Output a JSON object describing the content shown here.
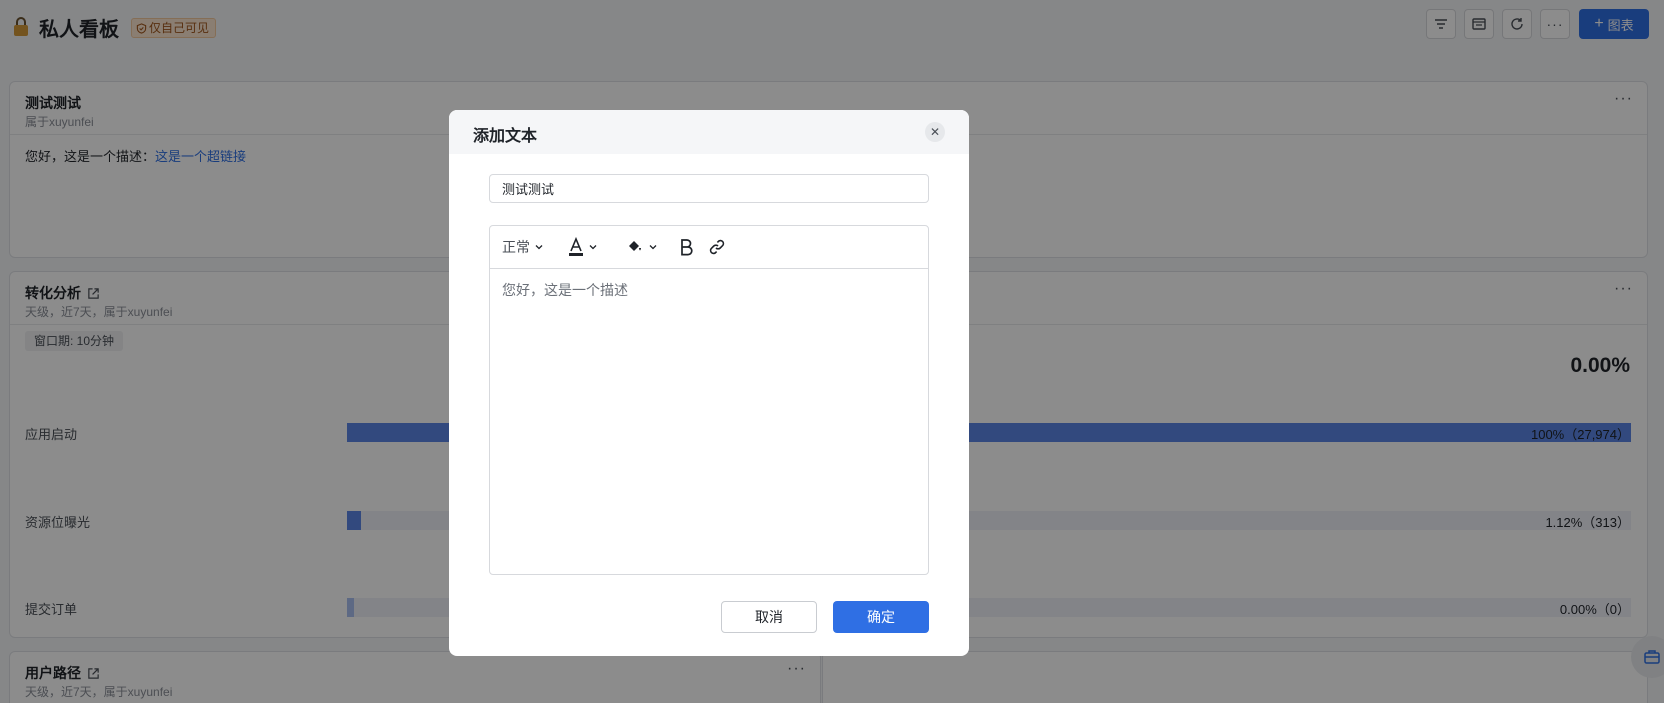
{
  "header": {
    "title": "私人看板",
    "badge": "仅自己可见",
    "add_chart_label": "图表"
  },
  "cards": {
    "text_card": {
      "title": "测试测试",
      "subtitle": "属于xuyunfei",
      "desc_prefix": "您好，这是一个描述：",
      "link_text": "这是一个超链接"
    },
    "funnel_card": {
      "title": "转化分析",
      "subtitle": "天级，近7天，属于xuyunfei",
      "window_tag": "窗口期: 10分钟",
      "overall_rate": "0.00%",
      "steps": [
        {
          "label": "应用启动",
          "value_text": "100%（27,974）",
          "fraction": 1.0
        },
        {
          "label": "资源位曝光",
          "value_text": "1.12%（313）",
          "fraction": 0.0112
        },
        {
          "label": "提交订单",
          "value_text": "0.00%（0）",
          "fraction": 0.0
        }
      ]
    },
    "path_card": {
      "title": "用户路径",
      "subtitle": "天级，近7天，属于xuyunfei"
    }
  },
  "modal": {
    "title": "添加文本",
    "title_value": "测试测试",
    "toolbar": {
      "paragraph_style": "正常"
    },
    "body_text": "您好，这是一个描述",
    "cancel_label": "取消",
    "ok_label": "确定"
  }
}
